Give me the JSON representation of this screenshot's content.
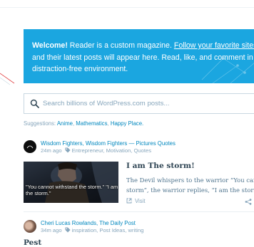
{
  "welcome": {
    "bold_lead": "Welcome!",
    "text_1": " Reader is a custom magazine. ",
    "link": "Follow your favorite sites",
    "text_2": " and their latest posts will appear here. Read, like, and comment in a distraction-free environment."
  },
  "search": {
    "placeholder": "Search billions of WordPress.com posts..."
  },
  "suggestions": {
    "label": "Suggestions: ",
    "items": [
      "Anime",
      "Mathematics",
      "Happy Place."
    ],
    "separator": ", "
  },
  "posts": [
    {
      "site": "Wisdom Fighters, Wisdom Fighters — Pictures Quotes",
      "time": "24m ago",
      "tags": "Entrepreneur, Motivation, Quotes",
      "title": "I am The storm!",
      "excerpt_lines": [
        "The Devil whispers to the warrior “You can",
        "storm”, the warrior replies, “I am the storm"
      ],
      "thumb_caption": "\"You cannot withstand the storm.\" \"I am the storm.\"",
      "visit_label": "Visit"
    },
    {
      "site": "Cheri Lucas Rowlands, The Daily Post",
      "time": "34m ago",
      "tags": "inspiration, Post Ideas, writing",
      "title": "Pest"
    }
  ],
  "colors": {
    "accent": "#1ba6e0",
    "link": "#0087be",
    "muted": "#87a6bc",
    "text": "#2e4453"
  },
  "icons": {
    "search": "search-icon",
    "tag": "tag-icon",
    "visit": "external-link-icon",
    "share": "share-icon"
  }
}
